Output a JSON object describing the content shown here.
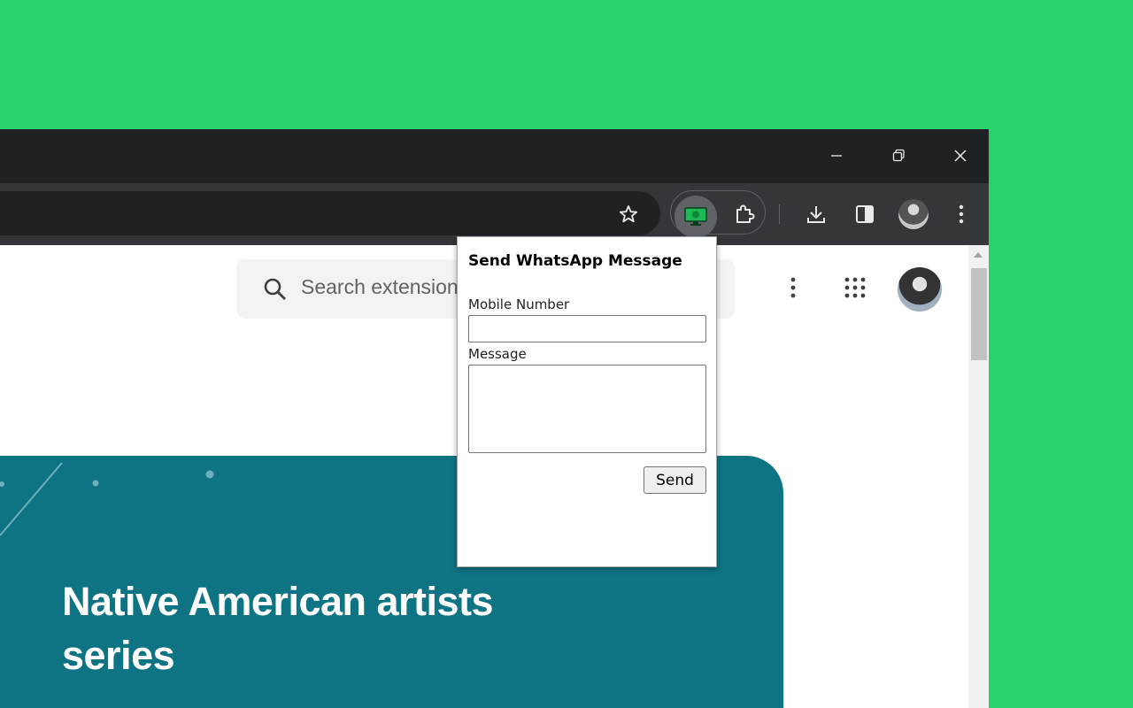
{
  "window_controls": {
    "minimize_icon": "minimize-icon",
    "restore_icon": "restore-icon",
    "close_icon": "close-icon"
  },
  "toolbar": {
    "bookmark_icon": "star-icon",
    "active_extension_icon": "whatsapp-sender-extension-icon",
    "extensions_icon": "puzzle-piece-icon",
    "download_icon": "download-icon",
    "side_panel_icon": "side-panel-icon",
    "profile_icon": "profile-avatar",
    "menu_icon": "kebab-menu-icon"
  },
  "page": {
    "search_placeholder": "Search extensions",
    "banner_title": "Native American artists series",
    "banner_color": "#0e7383"
  },
  "popup": {
    "title": "Send WhatsApp Message",
    "mobile_label": "Mobile Number",
    "mobile_value": "",
    "message_label": "Message",
    "message_value": "",
    "send_label": "Send"
  },
  "colors": {
    "background": "#27d36a",
    "titlebar": "#202124",
    "toolbar": "#35363a",
    "extension_active": "#1db954"
  }
}
